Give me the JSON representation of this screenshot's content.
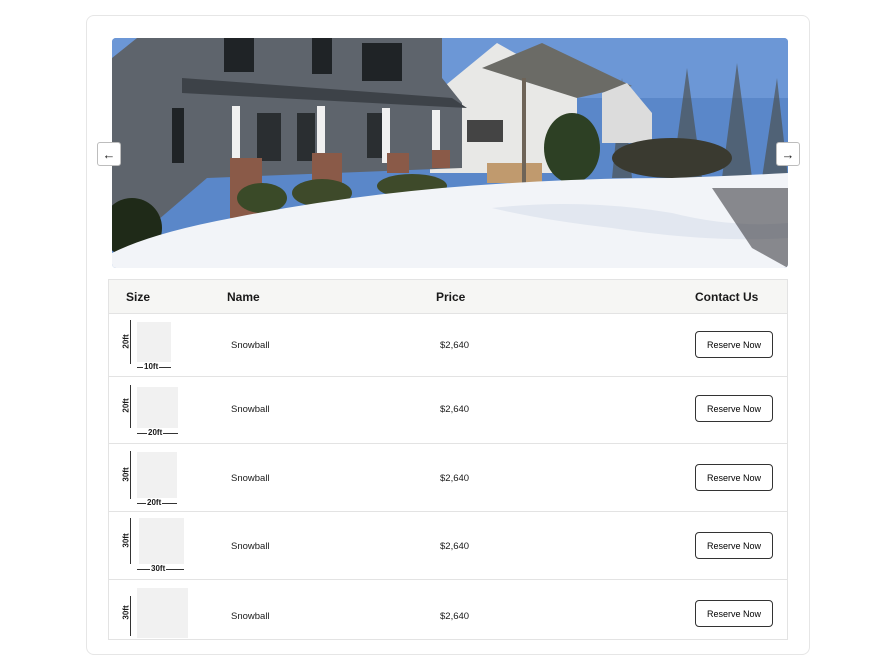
{
  "table": {
    "headers": {
      "size": "Size",
      "name": "Name",
      "price": "Price",
      "contact": "Contact Us"
    },
    "rows": [
      {
        "height_label": "20ft",
        "width_label": "10ft",
        "name": "Snowball",
        "price": "$2,640",
        "button": "Reserve Now"
      },
      {
        "height_label": "20ft",
        "width_label": "20ft",
        "name": "Snowball",
        "price": "$2,640",
        "button": "Reserve Now"
      },
      {
        "height_label": "30ft",
        "width_label": "20ft",
        "name": "Snowball",
        "price": "$2,640",
        "button": "Reserve Now"
      },
      {
        "height_label": "30ft",
        "width_label": "30ft",
        "name": "Snowball",
        "price": "$2,640",
        "button": "Reserve Now"
      },
      {
        "height_label": "30ft",
        "width_label": "",
        "name": "Snowball",
        "price": "$2,640",
        "button": "Reserve Now"
      }
    ]
  },
  "carousel": {
    "prev_icon": "arrow-left-icon",
    "next_icon": "arrow-right-icon"
  }
}
